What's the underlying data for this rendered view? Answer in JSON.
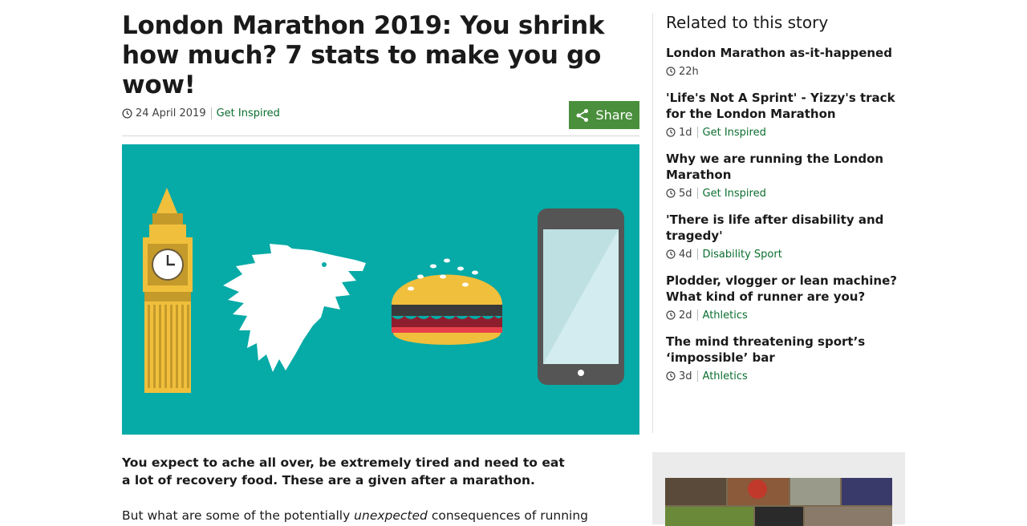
{
  "article": {
    "title": "London Marathon 2019: You shrink how much? 7 stats to make you go wow!",
    "date": "24 April 2019",
    "category": "Get Inspired",
    "share_label": "Share",
    "lead": "You expect to ache all over, be extremely tired and need to eat a lot of recovery food. These are a given after a marathon.",
    "body_prefix": "But what are some of the potentially ",
    "body_em": "unexpected",
    "body_suffix": " consequences of running"
  },
  "related": {
    "heading": "Related to this story",
    "items": [
      {
        "title": "London Marathon as-it-happened",
        "age": "22h",
        "category": ""
      },
      {
        "title": "'Life's Not A Sprint' - Yizzy's track for the London Marathon",
        "age": "1d",
        "category": "Get Inspired"
      },
      {
        "title": "Why we are running the London Marathon",
        "age": "5d",
        "category": "Get Inspired"
      },
      {
        "title": "'There is life after disability and tragedy'",
        "age": "4d",
        "category": "Disability Sport"
      },
      {
        "title": "Plodder, vlogger or lean machine? What kind of runner are you?",
        "age": "2d",
        "category": "Athletics"
      },
      {
        "title": "The mind threatening sport’s ‘impossible’ bar",
        "age": "3d",
        "category": "Athletics"
      }
    ]
  },
  "colors": {
    "accent_green": "#4a8f3c",
    "link_green": "#0b6e2f",
    "hero_bg": "#06aaa6"
  }
}
